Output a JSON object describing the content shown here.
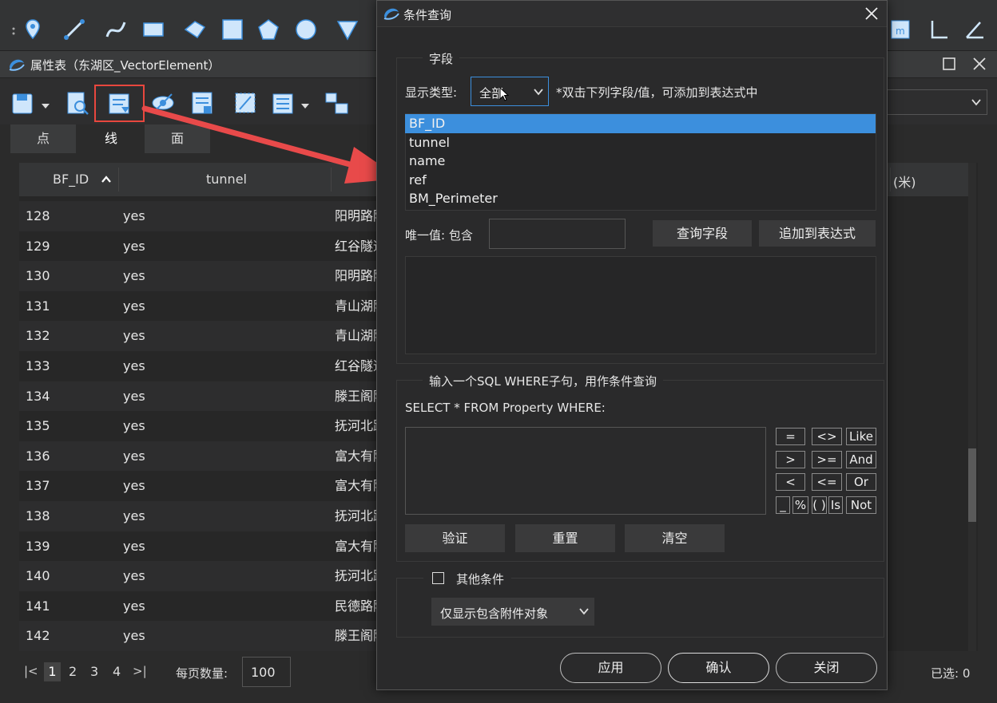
{
  "attr_window": {
    "title": "属性表（东湖区_VectorElement）",
    "tabs": [
      "点",
      "线",
      "面"
    ],
    "columns": [
      "BF_ID",
      "tunnel"
    ],
    "partial_column": "(米)",
    "rows": [
      {
        "id": "128",
        "tunnel": "yes",
        "name": "阳明路隧道"
      },
      {
        "id": "129",
        "tunnel": "yes",
        "name": "红谷隧道"
      },
      {
        "id": "130",
        "tunnel": "yes",
        "name": "阳明路隧道"
      },
      {
        "id": "131",
        "tunnel": "yes",
        "name": "青山湖隧道"
      },
      {
        "id": "132",
        "tunnel": "yes",
        "name": "青山湖隧道"
      },
      {
        "id": "133",
        "tunnel": "yes",
        "name": "红谷隧道"
      },
      {
        "id": "134",
        "tunnel": "yes",
        "name": "滕王阁隧道"
      },
      {
        "id": "135",
        "tunnel": "yes",
        "name": "抚河北路"
      },
      {
        "id": "136",
        "tunnel": "yes",
        "name": "富大有隧道"
      },
      {
        "id": "137",
        "tunnel": "yes",
        "name": "富大有隧道"
      },
      {
        "id": "138",
        "tunnel": "yes",
        "name": "抚河北路"
      },
      {
        "id": "139",
        "tunnel": "yes",
        "name": "富大有隧道"
      },
      {
        "id": "140",
        "tunnel": "yes",
        "name": "抚河北路"
      },
      {
        "id": "141",
        "tunnel": "yes",
        "name": "民德路隧道"
      },
      {
        "id": "142",
        "tunnel": "yes",
        "name": "滕王阁隧道"
      }
    ],
    "pager": {
      "first": "|<",
      "pages": [
        "1",
        "2",
        "3",
        "4"
      ],
      "last": ">|",
      "per_page_label": "每页数量:",
      "per_page_value": "100",
      "selected_label": "已选: 0"
    }
  },
  "dialog": {
    "title": "条件查询",
    "field_group_label": "字段",
    "display_type_label": "显示类型:",
    "display_type_value": "全部",
    "hint": "*双击下列字段/值，可添加到表达式中",
    "fields": [
      "BF_ID",
      "tunnel",
      "name",
      "ref",
      "BM_Perimeter"
    ],
    "selected_field_index": 0,
    "unique_label": "唯一值: 包含",
    "unique_value": "",
    "query_field_button": "查询字段",
    "append_button": "追加到表达式",
    "sql_group_label": "输入一个SQL WHERE子句，用作条件查询",
    "sql_prefix": "SELECT * FROM Property WHERE:",
    "sql_value": "",
    "operators": [
      [
        "=",
        "<>",
        "Like"
      ],
      [
        ">",
        ">=",
        "And"
      ],
      [
        "<",
        "<=",
        "Or"
      ]
    ],
    "op_row4": [
      "_",
      "%",
      "( )",
      "Is",
      "Not"
    ],
    "verify_button": "验证",
    "reset_button": "重置",
    "clear_button": "清空",
    "other_label": "其他条件",
    "other_checked": false,
    "attach_select": "仅显示包含附件对象",
    "apply_button": "应用",
    "ok_button": "确认",
    "close_button": "关闭"
  },
  "colors": {
    "accent": "#3c8fdd",
    "highlight_box": "#e8473e",
    "arrow": "#e84a4a"
  }
}
